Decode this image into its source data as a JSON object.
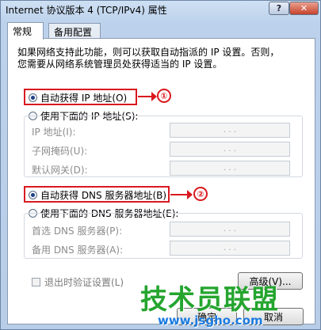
{
  "window": {
    "title": "Internet 协议版本 4 (TCP/IPv4) 属性",
    "help_glyph": "?",
    "close_glyph": "✕"
  },
  "tabs": [
    {
      "label": "常规",
      "active": true
    },
    {
      "label": "备用配置",
      "active": false
    }
  ],
  "description_lines": [
    "如果网络支持此功能，则可以获取自动指派的 IP 设置。否则，",
    "您需要从网络系统管理员处获得适当的 IP 设置。"
  ],
  "ip_section": {
    "auto_option": "自动获得 IP 地址(O)",
    "auto_selected": true,
    "manual_option": "使用下面的 IP 地址(S):",
    "fields": [
      {
        "label": "IP 地址(I):",
        "value": ". . ."
      },
      {
        "label": "子网掩码(U):",
        "value": ". . ."
      },
      {
        "label": "默认网关(D):",
        "value": ". . ."
      }
    ],
    "annotation": "①"
  },
  "dns_section": {
    "auto_option": "自动获得 DNS 服务器地址(B)",
    "auto_selected": true,
    "manual_option": "使用下面的 DNS 服务器地址(E):",
    "fields": [
      {
        "label": "首选 DNS 服务器(P):",
        "value": ". . ."
      },
      {
        "label": "备用 DNS 服务器(A):",
        "value": ". . ."
      }
    ],
    "annotation": "②"
  },
  "validate_on_exit": {
    "label": "退出时验证设置(L)",
    "checked": false
  },
  "buttons": {
    "advanced": "高级(V)...",
    "ok": "确定",
    "cancel": "取消"
  },
  "watermark": {
    "text": "技术员联盟",
    "url": "www.jsgho.com"
  },
  "colors": {
    "annotation_red": "#d9191f",
    "watermark_green": "#25a52f",
    "watermark_blue": "#1b7be0"
  }
}
